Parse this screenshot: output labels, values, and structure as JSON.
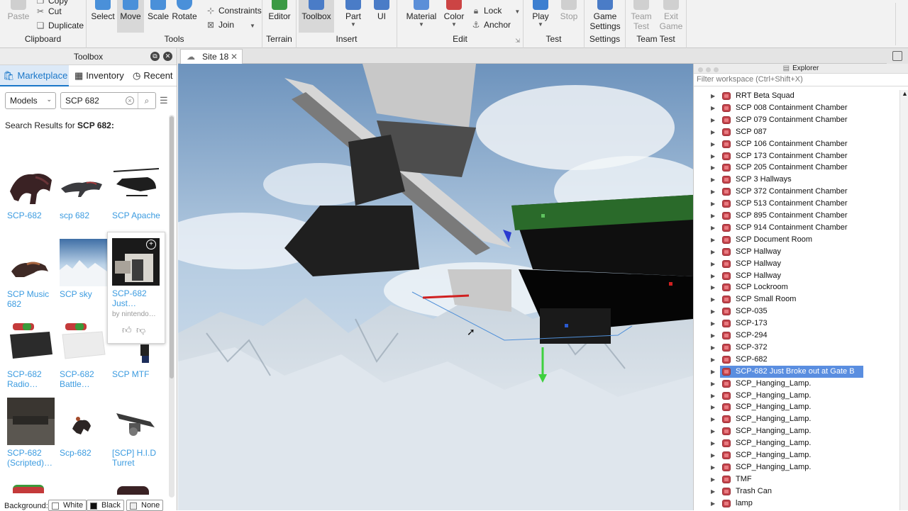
{
  "ribbon": {
    "clipboard": {
      "label": "Clipboard",
      "paste": "Paste",
      "copy": "Copy",
      "cut": "Cut",
      "duplicate": "Duplicate"
    },
    "tools": {
      "label": "Tools",
      "select": "Select",
      "move": "Move",
      "scale": "Scale",
      "rotate": "Rotate",
      "constraints": "Constraints",
      "join": "Join"
    },
    "terrain": {
      "label": "Terrain",
      "editor": "Editor"
    },
    "insert": {
      "label": "Insert",
      "toolbox": "Toolbox",
      "part": "Part",
      "ui": "UI"
    },
    "edit": {
      "label": "Edit",
      "material": "Material",
      "color": "Color",
      "lock": "Lock",
      "anchor": "Anchor"
    },
    "test": {
      "label": "Test",
      "play": "Play",
      "stop": "Stop"
    },
    "settings": {
      "label": "Settings",
      "game_settings": "Game Settings"
    },
    "team_test": {
      "label": "Team Test",
      "team_test": "Team Test",
      "exit_game": "Exit Game"
    }
  },
  "toolbox": {
    "title": "Toolbox",
    "tabs": [
      "Marketplace",
      "Inventory",
      "Recent"
    ],
    "category": "Models",
    "search_value": "SCP 682",
    "results_prefix": "Search Results for ",
    "results_query": "SCP 682:",
    "items": [
      {
        "name": "SCP-682",
        "thumb": "creature"
      },
      {
        "name": "scp 682",
        "thumb": "lizard"
      },
      {
        "name": "SCP Apache",
        "thumb": "helicopter"
      },
      {
        "name": "SCP Music 682",
        "thumb": "lizard-small"
      },
      {
        "name": "SCP sky",
        "thumb": "sky"
      },
      {
        "name": "SCP-682 Just…",
        "thumb": "room",
        "creator": "by nintendo…"
      },
      {
        "name": "SCP-682 Radio…",
        "thumb": "radio"
      },
      {
        "name": "SCP-682 Battle…",
        "thumb": "battle"
      },
      {
        "name": "SCP MTF",
        "thumb": "mtf"
      },
      {
        "name": "SCP-682 (Scripted)…",
        "thumb": "scripted"
      },
      {
        "name": "Scp-682",
        "thumb": "small-creature"
      },
      {
        "name": "[SCP] H.I.D Turret",
        "thumb": "turret"
      }
    ],
    "background_label": "Background:",
    "background_options": [
      "White",
      "Black",
      "None"
    ]
  },
  "viewport": {
    "tab_label": "Site 18"
  },
  "explorer": {
    "title": "Explorer",
    "filter_placeholder": "Filter workspace (Ctrl+Shift+X)",
    "selected_index": 23,
    "items": [
      "RRT Beta Squad",
      "SCP 008 Containment Chamber",
      "SCP 079 Containment Chamber",
      "SCP 087",
      "SCP 106 Containment Chamber",
      "SCP 173 Containment Chamber",
      "SCP 205 Containment Chamber",
      "SCP 3 Hallways",
      "SCP 372 Containment Chamber",
      "SCP 513 Containment Chamber",
      "SCP 895 Containment Chamber",
      "SCP 914 Containment Chamber",
      "SCP Document Room",
      "SCP Hallway",
      "SCP Hallway",
      "SCP Hallway",
      "SCP Lockroom",
      "SCP Small Room",
      "SCP-035",
      "SCP-173",
      "SCP-294",
      "SCP-372",
      "SCP-682",
      "SCP-682 Just Broke out at Gate B",
      "SCP_Hanging_Lamp.",
      "SCP_Hanging_Lamp.",
      "SCP_Hanging_Lamp.",
      "SCP_Hanging_Lamp.",
      "SCP_Hanging_Lamp.",
      "SCP_Hanging_Lamp.",
      "SCP_Hanging_Lamp.",
      "SCP_Hanging_Lamp.",
      "TMF",
      "Trash Can",
      "lamp"
    ]
  },
  "colors": {
    "accent": "#1a77c9",
    "link": "#3b9be0",
    "selection": "#5a8ee0"
  }
}
